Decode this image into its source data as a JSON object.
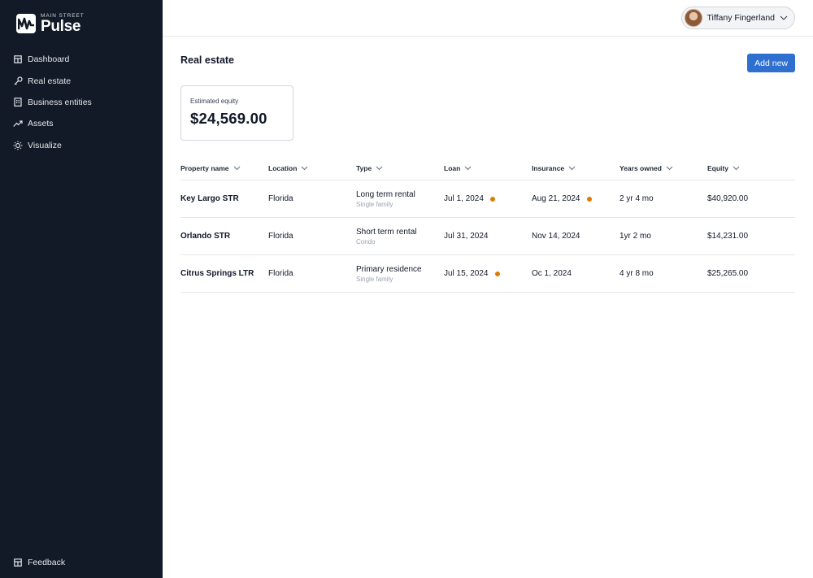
{
  "brand": {
    "small": "MAIN STREET",
    "big": "Pulse"
  },
  "sidebar": {
    "items": [
      {
        "label": "Dashboard",
        "icon": "dashboard-icon"
      },
      {
        "label": "Real estate",
        "icon": "key-icon"
      },
      {
        "label": "Business entities",
        "icon": "building-icon"
      },
      {
        "label": "Assets",
        "icon": "trending-up-icon"
      },
      {
        "label": "Visualize",
        "icon": "lightbulb-icon"
      }
    ],
    "feedback": {
      "label": "Feedback",
      "icon": "feedback-icon"
    }
  },
  "user": {
    "name": "Tiffany Fingerland"
  },
  "page": {
    "title": "Real estate",
    "add_label": "Add new",
    "equity_label": "Estimated equity",
    "equity_value": "$24,569.00"
  },
  "table": {
    "headers": [
      "Property name",
      "Location",
      "Type",
      "Loan",
      "Insurance",
      "Years owned",
      "Equity"
    ],
    "rows": [
      {
        "name": "Key Largo STR",
        "location": "Florida",
        "type": "Long term rental",
        "subtype": "Single family",
        "loan": "Jul 1, 2024",
        "loan_flag": true,
        "insurance": "Aug 21, 2024",
        "insurance_flag": true,
        "years": "2 yr 4 mo",
        "equity": "$40,920.00"
      },
      {
        "name": "Orlando STR",
        "location": "Florida",
        "type": "Short term rental",
        "subtype": "Condo",
        "loan": "Jul 31, 2024",
        "loan_flag": false,
        "insurance": "Nov 14, 2024",
        "insurance_flag": false,
        "years": "1yr 2 mo",
        "equity": "$14,231.00"
      },
      {
        "name": "Citrus Springs LTR",
        "location": "Florida",
        "type": "Primary residence",
        "subtype": "Single family",
        "loan": "Jul 15, 2024",
        "loan_flag": true,
        "insurance": "Oc 1, 2024",
        "insurance_flag": false,
        "years": "4 yr 8 mo",
        "equity": "$25,265.00"
      }
    ]
  },
  "colors": {
    "sidebar_bg": "#121a27",
    "accent": "#2f6fd0",
    "warning_dot": "#e07b00"
  }
}
